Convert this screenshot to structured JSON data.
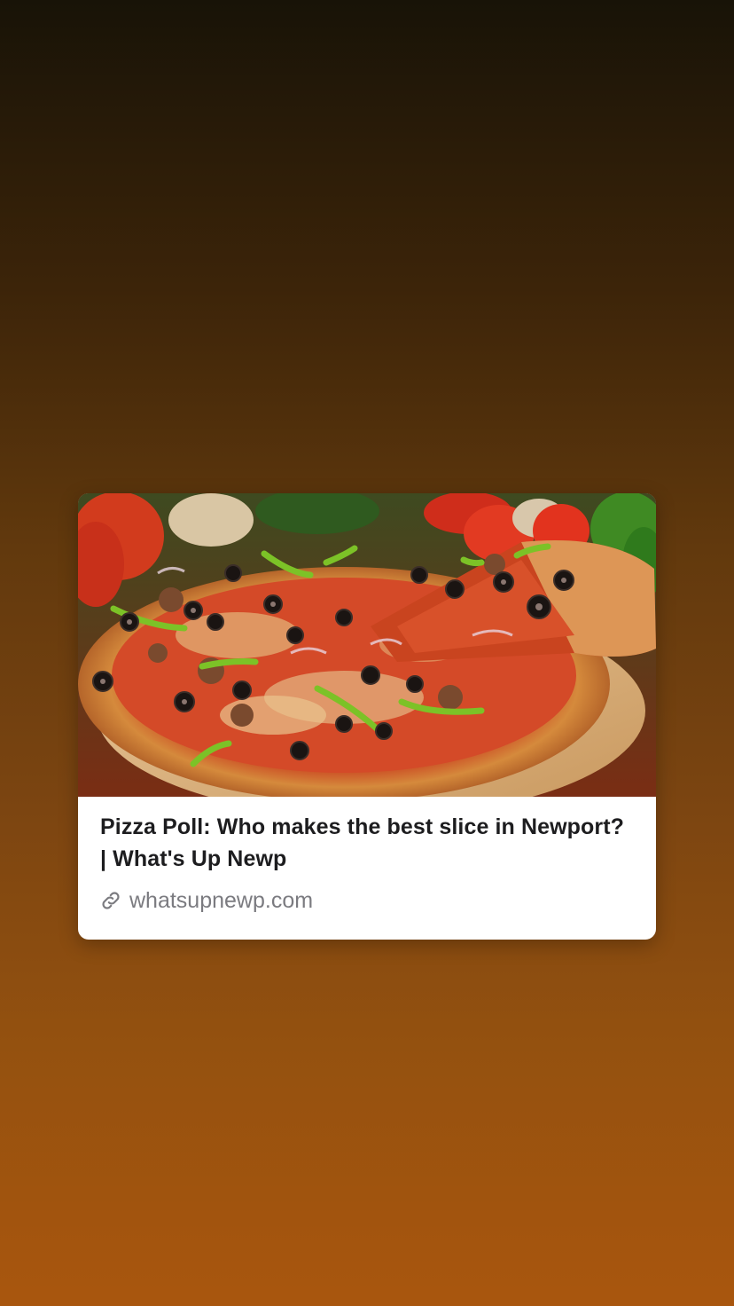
{
  "link_card": {
    "title": "Pizza Poll: Who makes the best slice in Newport? | What's Up Newp",
    "domain": "whatsupnewp.com",
    "image_subject": "supreme pizza with olives, peppers, sausage and a lifted slice",
    "link_icon": "link-icon"
  },
  "colors": {
    "background_top": "#181307",
    "background_bottom": "#a9560e",
    "card_background": "#ffffff",
    "title_text": "#1d1d1f",
    "domain_text": "#7b7b80"
  }
}
